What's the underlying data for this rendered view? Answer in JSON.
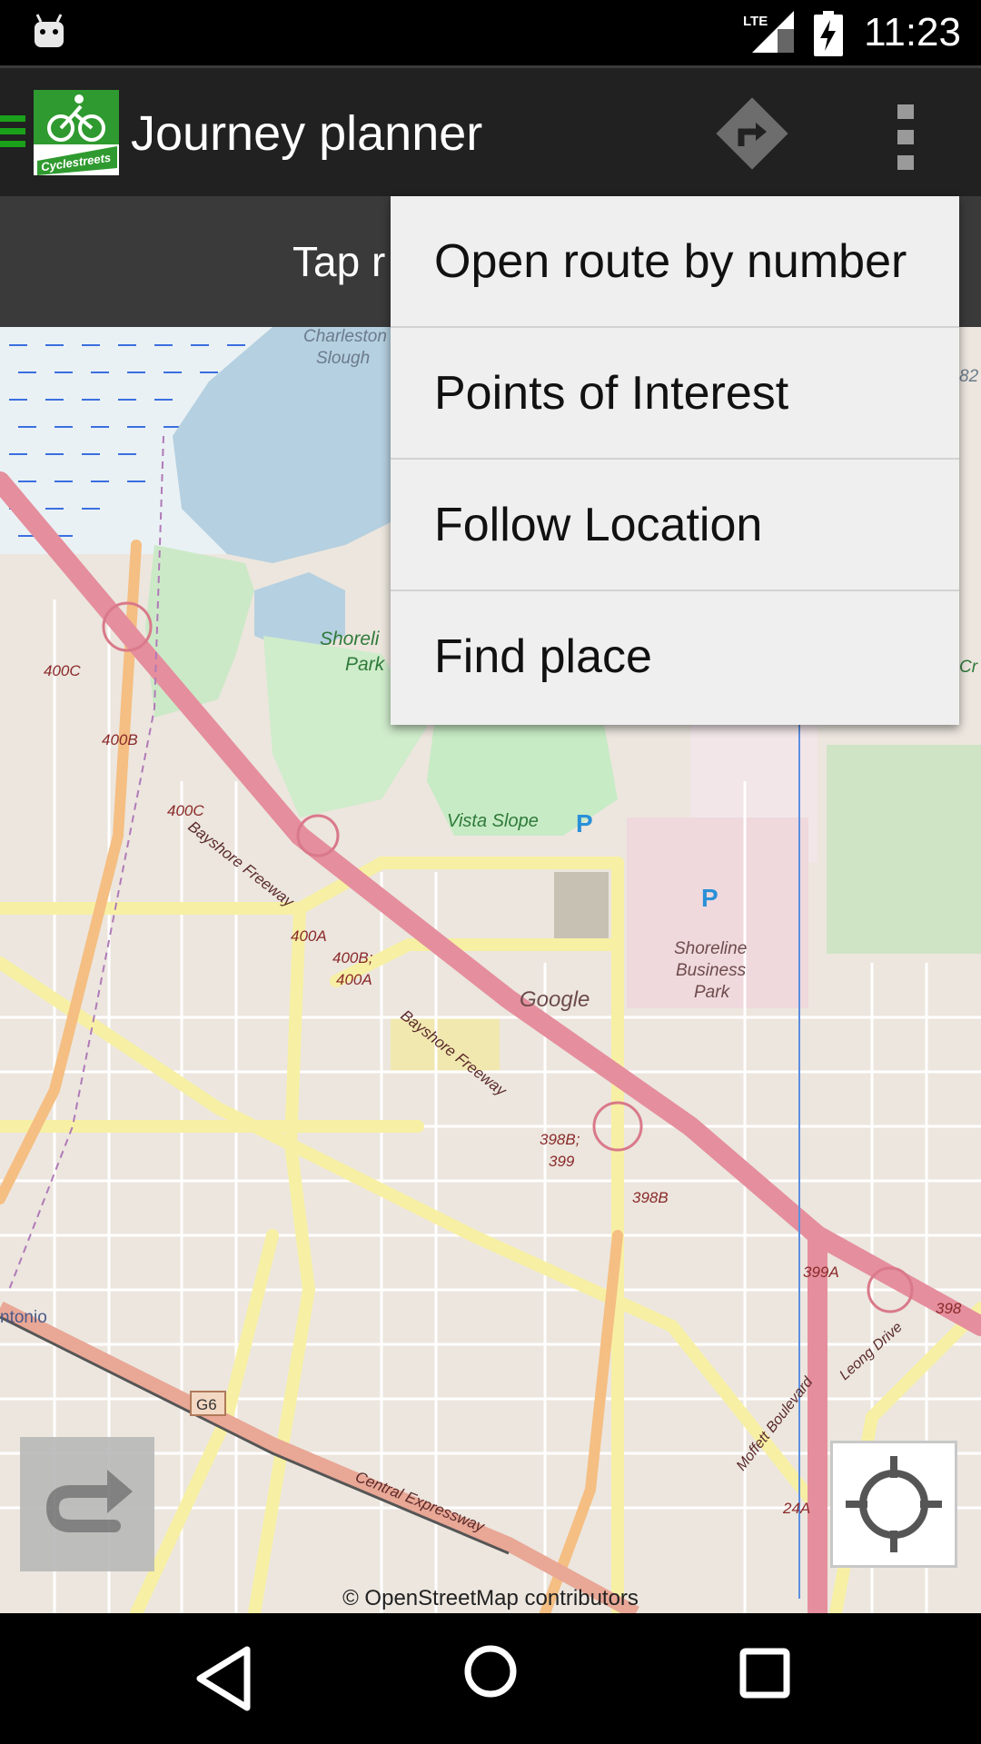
{
  "status_bar": {
    "time": "11:23",
    "network_label": "LTE"
  },
  "action_bar": {
    "title": "Journey planner",
    "logo_text": "Cyclestreets"
  },
  "hint_bar": {
    "text": "Tap r"
  },
  "overflow_menu": {
    "items": [
      {
        "label": "Open route by number"
      },
      {
        "label": "Points of Interest"
      },
      {
        "label": "Follow Location"
      },
      {
        "label": "Find place"
      }
    ]
  },
  "map": {
    "attribution": "© OpenStreetMap contributors",
    "labels": {
      "charleston": "Charleston",
      "slough": "Slough",
      "shoreline_park_1": "Shoreli",
      "shoreline_park_2": "Park",
      "vista_slope": "Vista Slope",
      "shoreline_business_1": "Shoreline",
      "shoreline_business_2": "Business",
      "shoreline_business_3": "Park",
      "google": "Google",
      "bayshore_1": "Bayshore Freeway",
      "bayshore_2": "Bayshore Freeway",
      "central_expressway": "Central Expressway",
      "moffett": "Moffett Boulevard",
      "leong": "Leong Drive",
      "antonio": "ntonio",
      "exit_400c_1": "400C",
      "exit_400b": "400B",
      "exit_400c_2": "400C",
      "exit_400a": "400A",
      "exit_400b_400a_1": "400B;",
      "exit_400b_400a_2": "400A",
      "exit_398b_399_1": "398B;",
      "exit_398b_399_2": "399",
      "exit_398b": "398B",
      "exit_399a": "399A",
      "exit_398": "398",
      "exit_24a": "24A",
      "route_g6": "G6",
      "parking_1": "P",
      "parking_2": "P",
      "edge_82": "82",
      "edge_cr": "Cr"
    }
  }
}
